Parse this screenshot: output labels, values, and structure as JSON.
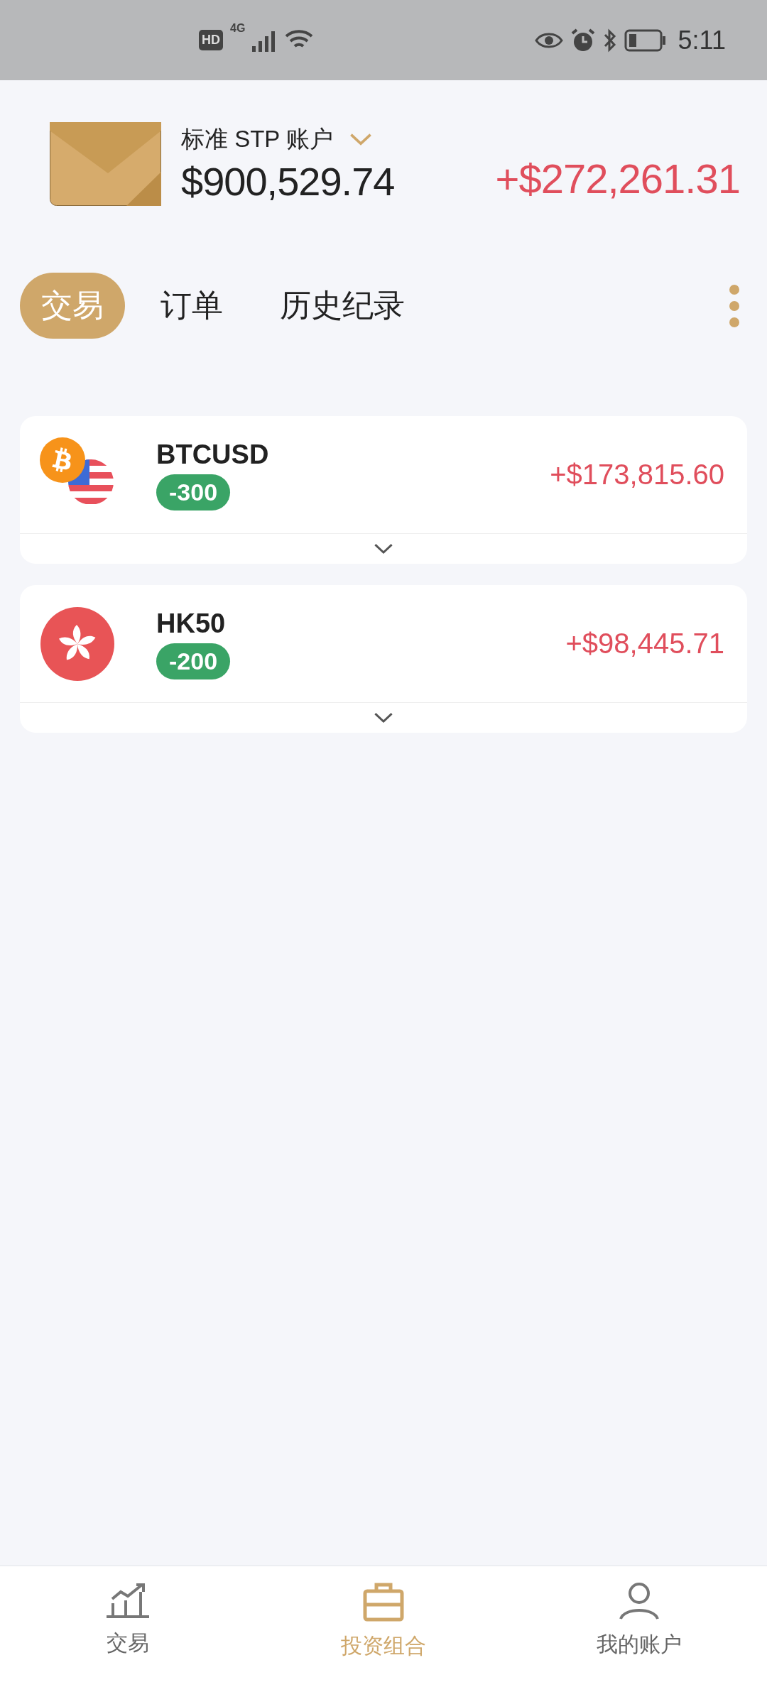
{
  "status_bar": {
    "hd": "HD",
    "network": "4G",
    "time": "5:11"
  },
  "account": {
    "name": "标准 STP 账户",
    "balance": "$900,529.74",
    "profit": "+$272,261.31"
  },
  "tabs": [
    {
      "label": "交易",
      "selected": true
    },
    {
      "label": "订单",
      "selected": false
    },
    {
      "label": "历史纪录",
      "selected": false
    }
  ],
  "positions": [
    {
      "kind": "crypto-usd",
      "symbol": "BTCUSD",
      "quantity": "-300",
      "profit": "+$173,815.60",
      "expanded": false
    },
    {
      "kind": "hk-index",
      "symbol": "HK50",
      "quantity": "-200",
      "profit": "+$98,445.71",
      "expanded": false
    }
  ],
  "bottom_nav": [
    {
      "kind": "chart",
      "label": "交易",
      "selected": false
    },
    {
      "kind": "briefcase",
      "label": "投资组合",
      "selected": true
    },
    {
      "kind": "person",
      "label": "我的账户",
      "selected": false
    }
  ]
}
